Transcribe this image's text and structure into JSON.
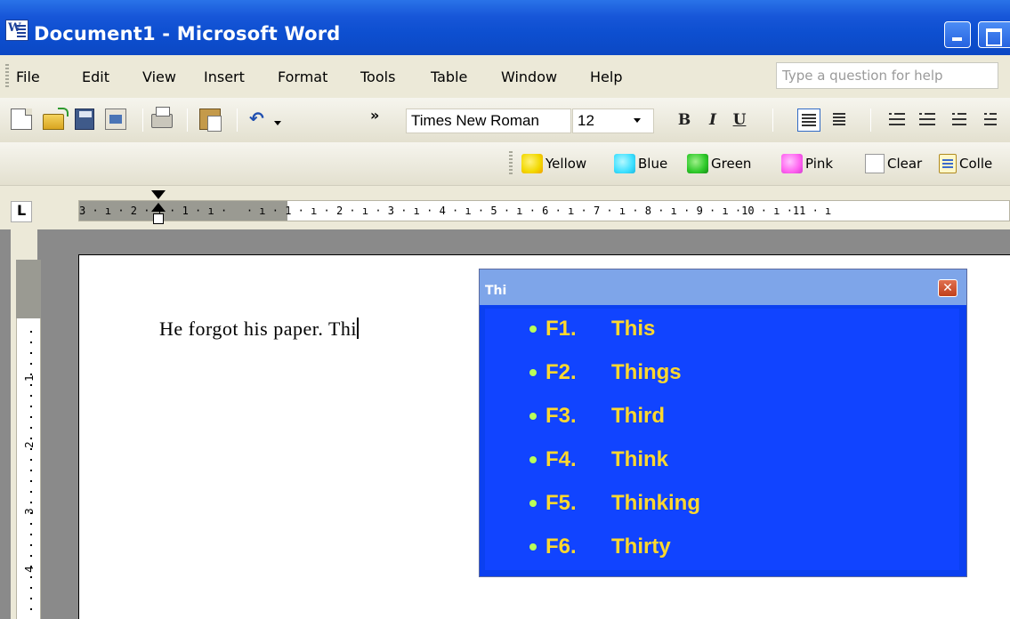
{
  "window": {
    "title": "Document1 - Microsoft Word",
    "app_icon_letter": "W"
  },
  "menu": {
    "items": [
      "File",
      "Edit",
      "View",
      "Insert",
      "Format",
      "Tools",
      "Table",
      "Window",
      "Help"
    ],
    "help_placeholder": "Type a question for help"
  },
  "toolbar": {
    "font_name": "Times New Roman",
    "font_size": "12",
    "bold": "B",
    "italic": "I",
    "underline": "U"
  },
  "highlight_toolbar": {
    "items": [
      "Yellow",
      "Blue",
      "Green",
      "Pink",
      "Clear",
      "Colle"
    ]
  },
  "ruler": {
    "text": "3 · ı · 2 · ı · 1 · ı ·   · ı · 1 · ı · 2 · ı · 3 · ı · 4 · ı · 5 · ı · 6 · ı · 7 · ı · 8 · ı · 9 · ı ·10 · ı ·11 · ı",
    "vertical_numbers": [
      "1",
      "2",
      "3",
      "4"
    ]
  },
  "document": {
    "text": "He forgot his paper. Thi"
  },
  "popup": {
    "title": "Thi",
    "suggestions": [
      {
        "key": "F1.",
        "word": "This"
      },
      {
        "key": "F2.",
        "word": "Things"
      },
      {
        "key": "F3.",
        "word": "Third"
      },
      {
        "key": "F4.",
        "word": "Think"
      },
      {
        "key": "F5.",
        "word": "Thinking"
      },
      {
        "key": "F6.",
        "word": "Thirty"
      }
    ]
  }
}
